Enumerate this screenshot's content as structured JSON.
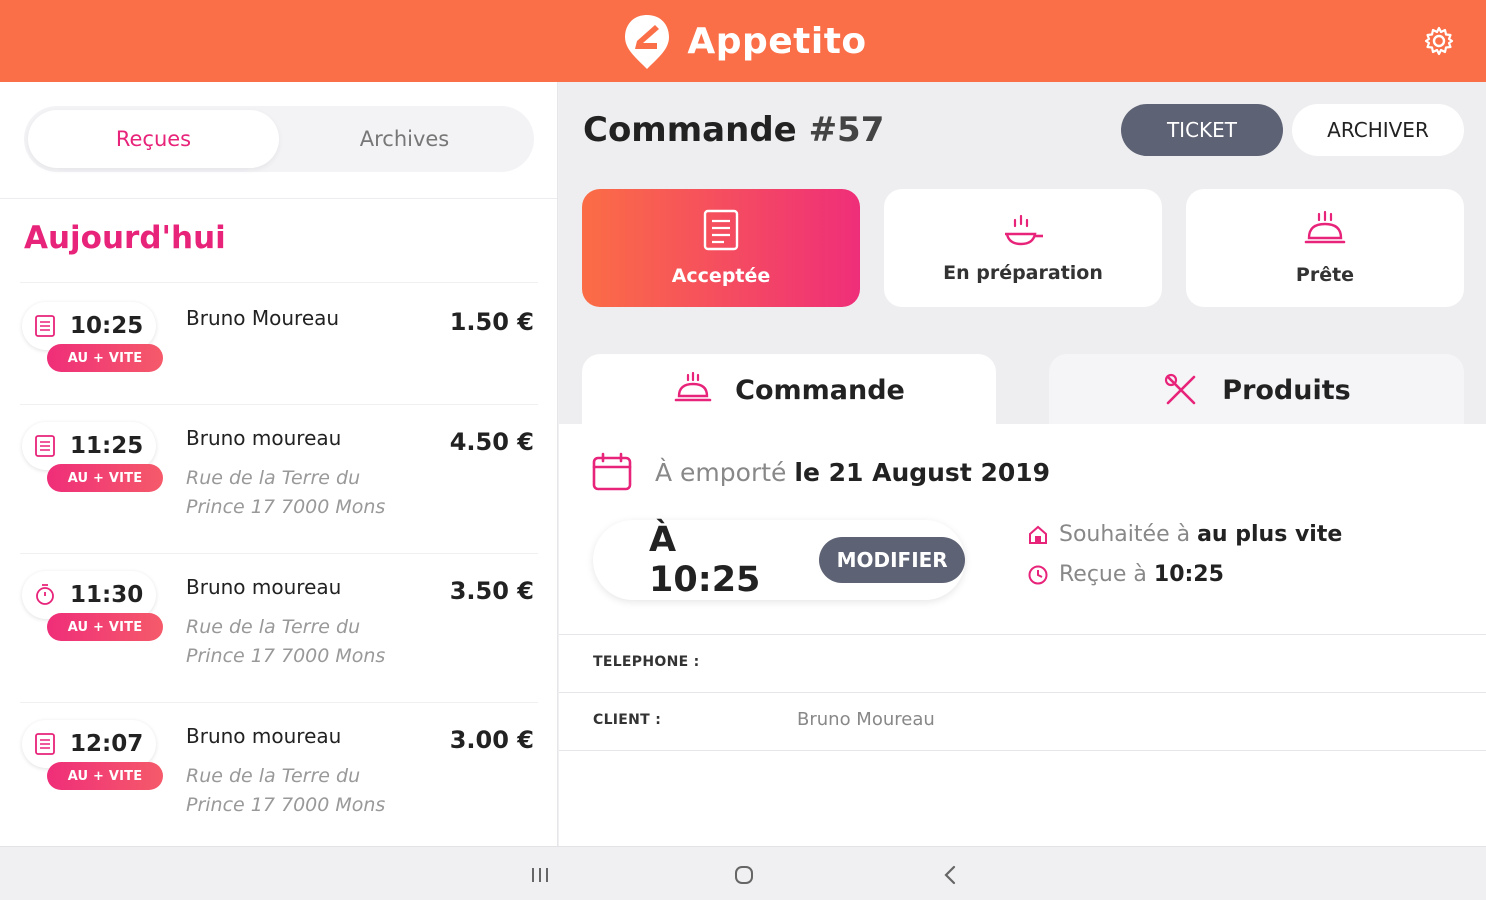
{
  "app": {
    "name": "Appetito"
  },
  "colors": {
    "brand": "#fa6f47",
    "accent": "#e8237a",
    "dark_button": "#5d6274"
  },
  "left": {
    "tabs": [
      {
        "label": "Reçues",
        "active": true
      },
      {
        "label": "Archives",
        "active": false
      }
    ],
    "section": "Aujourd'hui",
    "orders": [
      {
        "time": "10:25",
        "badge": "AU + VITE",
        "customer": "Bruno Moureau",
        "address_1": "",
        "address_2": "",
        "price": "1.50 €",
        "icon": "receipt-icon"
      },
      {
        "time": "11:25",
        "badge": "AU + VITE",
        "customer": "Bruno moureau",
        "address_1": "Rue de la Terre du",
        "address_2": "Prince 17 7000 Mons",
        "price": "4.50 €",
        "icon": "receipt-icon"
      },
      {
        "time": "11:30",
        "badge": "AU + VITE",
        "customer": "Bruno moureau",
        "address_1": "Rue de la Terre du",
        "address_2": "Prince 17 7000 Mons",
        "price": "3.50 €",
        "icon": "timer-icon"
      },
      {
        "time": "12:07",
        "badge": "AU + VITE",
        "customer": "Bruno moureau",
        "address_1": "Rue de la Terre du",
        "address_2": "Prince 17 7000 Mons",
        "price": "3.00 €",
        "icon": "receipt-icon"
      }
    ]
  },
  "right": {
    "title_prefix": "Commande",
    "order_number": "#57",
    "ticket_label": "TICKET",
    "archive_label": "ARCHIVER",
    "statuses": [
      {
        "label": "Acceptée",
        "active": true,
        "icon": "receipt-icon"
      },
      {
        "label": "En préparation",
        "active": false,
        "icon": "frying-pan-icon"
      },
      {
        "label": "Prête",
        "active": false,
        "icon": "cloche-icon"
      }
    ],
    "tabs": [
      {
        "label": "Commande",
        "active": true,
        "icon": "cloche-icon"
      },
      {
        "label": "Produits",
        "active": false,
        "icon": "utensils-icon"
      }
    ],
    "date_muted": "À emporté",
    "date_strong": "le 21 August 2019",
    "time_label": "À 10:25",
    "modify_label": "MODIFIER",
    "wished_muted": "Souhaitée à",
    "wished_strong": "au plus vite",
    "received_muted": "Reçue à",
    "received_strong": "10:25",
    "phone_label": "TELEPHONE :",
    "phone_value": "",
    "client_label": "CLIENT :",
    "client_value": "Bruno Moureau"
  },
  "navbar": {
    "recent_icon": "recent-apps-icon",
    "home_icon": "home-icon",
    "back_icon": "back-icon"
  }
}
